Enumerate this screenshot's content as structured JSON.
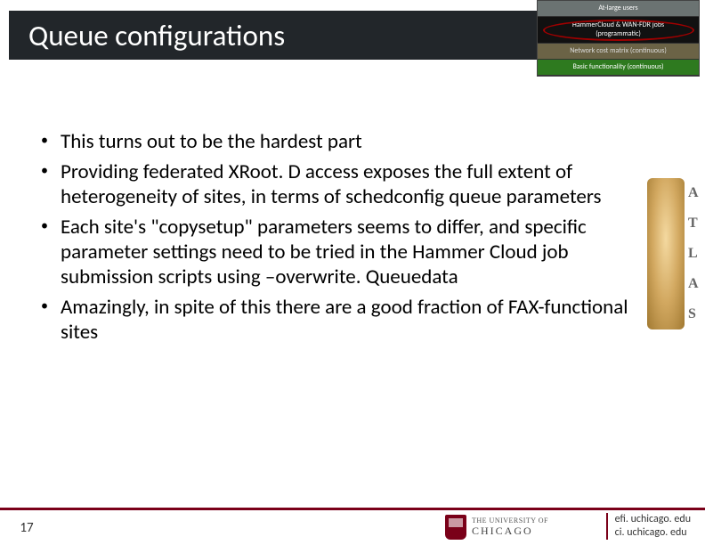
{
  "title": "Queue configurations",
  "stack": {
    "atlarge": "At-large users",
    "hammer_line1": "HammerCloud & WAN-FDR jobs",
    "hammer_line2": "(programmatic)",
    "network": "Network cost matrix (continuous)",
    "basic": "Basic functionality (continuous)"
  },
  "bullets": [
    "This turns out to be the hardest part",
    "Providing federated XRoot. D access exposes the full extent of heterogeneity of sites, in terms of schedconfig queue parameters",
    "Each site's \"copysetup\" parameters seems to differ, and specific parameter settings need to be tried in the Hammer Cloud job submission scripts using –overwrite. Queuedata",
    "Amazingly, in spite of this there are a good fraction of FAX-functional sites"
  ],
  "atlas_letters": [
    "A",
    "T",
    "L",
    "A",
    "S"
  ],
  "footer": {
    "page": "17",
    "university_small": "THE UNIVERSITY OF",
    "university_big": "CHICAGO",
    "url1": "efi. uchicago. edu",
    "url2": "ci. uchicago. edu"
  }
}
